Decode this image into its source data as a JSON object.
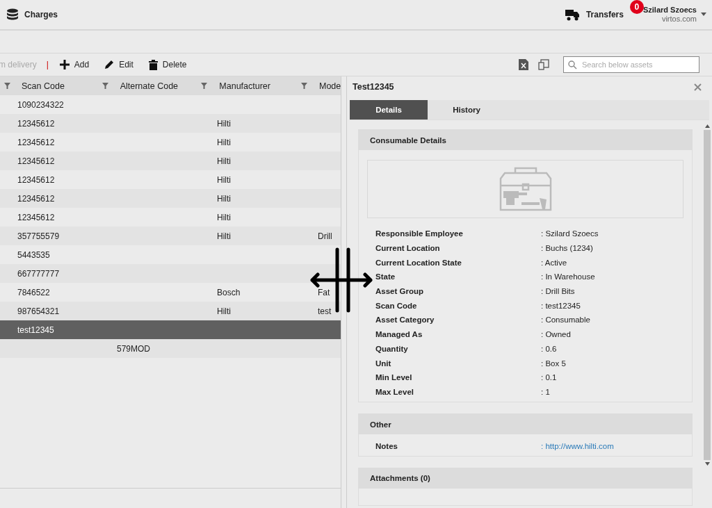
{
  "topbar": {
    "charges": "Charges",
    "transfers": "Transfers",
    "transfer_count": "0",
    "user": "Szilard Szoecs",
    "domain": "virtos.com"
  },
  "toolbar": {
    "cut_action": "m delivery",
    "separator": "|",
    "actions": [
      {
        "kind": "add",
        "label": "Add"
      },
      {
        "kind": "edit",
        "label": "Edit"
      },
      {
        "kind": "delete",
        "label": "Delete"
      }
    ],
    "search": {
      "placeholder": "Search below assets"
    }
  },
  "table": {
    "columns": [
      "Scan Code",
      "Alternate Code",
      "Manufacturer",
      "Mode"
    ],
    "rows": [
      {
        "scan": "1090234322",
        "alt": "",
        "maker": "",
        "model": "",
        "selected": false
      },
      {
        "scan": "12345612",
        "alt": "",
        "maker": "Hilti",
        "model": "",
        "selected": false
      },
      {
        "scan": "12345612",
        "alt": "",
        "maker": "Hilti",
        "model": "",
        "selected": false
      },
      {
        "scan": "12345612",
        "alt": "",
        "maker": "Hilti",
        "model": "",
        "selected": false
      },
      {
        "scan": "12345612",
        "alt": "",
        "maker": "Hilti",
        "model": "",
        "selected": false
      },
      {
        "scan": "12345612",
        "alt": "",
        "maker": "Hilti",
        "model": "",
        "selected": false
      },
      {
        "scan": "12345612",
        "alt": "",
        "maker": "Hilti",
        "model": "",
        "selected": false
      },
      {
        "scan": "357755579",
        "alt": "",
        "maker": "Hilti",
        "model": "Drill",
        "selected": false
      },
      {
        "scan": "5443535",
        "alt": "",
        "maker": "",
        "model": "",
        "selected": false
      },
      {
        "scan": "667777777",
        "alt": "",
        "maker": "",
        "model": "",
        "selected": false
      },
      {
        "scan": "7846522",
        "alt": "",
        "maker": "Bosch",
        "model": "Fat",
        "selected": false
      },
      {
        "scan": "987654321",
        "alt": "",
        "maker": "Hilti",
        "model": "test",
        "selected": false
      },
      {
        "scan": "test12345",
        "alt": "",
        "maker": "",
        "model": "",
        "selected": true
      },
      {
        "scan": "",
        "alt": "579MOD",
        "maker": "",
        "model": "",
        "selected": false
      }
    ]
  },
  "detail": {
    "title": "Test12345",
    "tabs": [
      {
        "label": "Details",
        "selected": true
      },
      {
        "label": "History",
        "selected": false
      }
    ],
    "sections": [
      {
        "title": "Consumable Details",
        "picture": true,
        "fields": [
          {
            "label": "Responsible Employee",
            "sep": ":",
            "value": "Szilard Szoecs"
          },
          {
            "label": "Current Location",
            "sep": ":",
            "value": "Buchs (1234)"
          },
          {
            "label": "Current Location State",
            "sep": ":",
            "value": "Active"
          },
          {
            "label": "State",
            "sep": ":",
            "value": "In Warehouse"
          },
          {
            "label": "Asset Group",
            "sep": ":",
            "value": "Drill Bits"
          },
          {
            "label": "Scan Code",
            "sep": ":",
            "value": "test12345"
          },
          {
            "label": "Asset Category",
            "sep": ":",
            "value": "Consumable"
          },
          {
            "label": "Managed As",
            "sep": ":",
            "value": "Owned"
          },
          {
            "label": "Quantity",
            "sep": ":",
            "value": "0.6"
          },
          {
            "label": "Unit",
            "sep": ":",
            "value": "Box 5"
          },
          {
            "label": "Min Level",
            "sep": ":",
            "value": "0.1"
          },
          {
            "label": "Max Level",
            "sep": ":",
            "value": "1"
          }
        ]
      },
      {
        "title": "Other",
        "picture": false,
        "fields": [
          {
            "label": "Notes",
            "sep": ":",
            "value": "http://www.hilti.com",
            "kind": "link"
          }
        ]
      },
      {
        "title": "Attachments (0)",
        "picture": false
      }
    ]
  }
}
